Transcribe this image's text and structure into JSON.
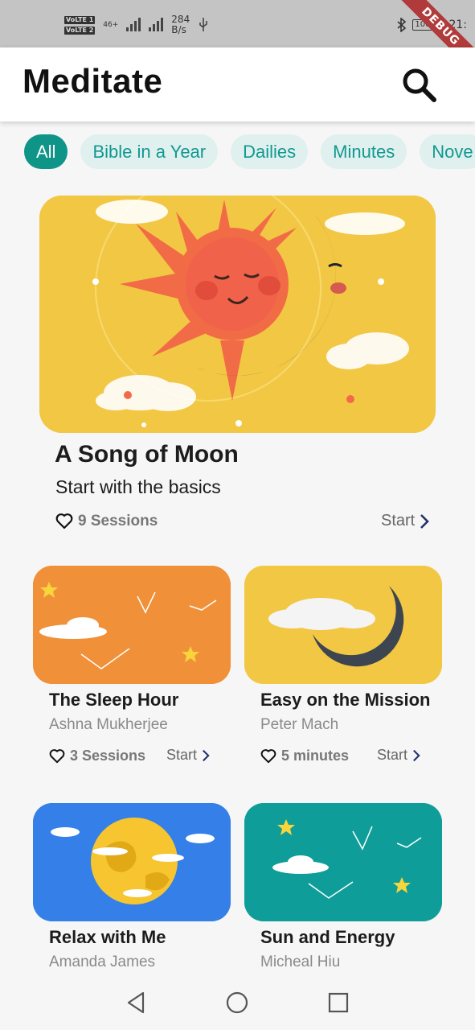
{
  "status_bar": {
    "volte1": "VoLTE 1",
    "volte2": "VoLTE 2",
    "network": "46+",
    "speed_value": "284",
    "speed_unit": "B/s",
    "battery": "100",
    "time": "21:",
    "debug_banner": "DEBUG"
  },
  "app_bar": {
    "title": "Meditate"
  },
  "chips": [
    "All",
    "Bible in a Year",
    "Dailies",
    "Minutes",
    "Nove"
  ],
  "featured": {
    "title": "A Song of Moon",
    "subtitle": "Start with the basics",
    "meta": "9 Sessions",
    "start_label": "Start"
  },
  "cards": [
    {
      "title": "The Sleep Hour",
      "author": "Ashna Mukherjee",
      "meta": "3 Sessions",
      "start_label": "Start",
      "bg": "#f0913a"
    },
    {
      "title": "Easy on the Mission",
      "author": "Peter Mach",
      "meta": "5 minutes",
      "start_label": "Start",
      "bg": "#f2c744"
    },
    {
      "title": "Relax with Me",
      "author": "Amanda James",
      "bg": "#3480e8"
    },
    {
      "title": "Sun and Energy",
      "author": "Micheal Hiu",
      "bg": "#0f9d9a"
    }
  ],
  "colors": {
    "accent": "#0f9488",
    "chip_bg": "#dff0ef"
  }
}
